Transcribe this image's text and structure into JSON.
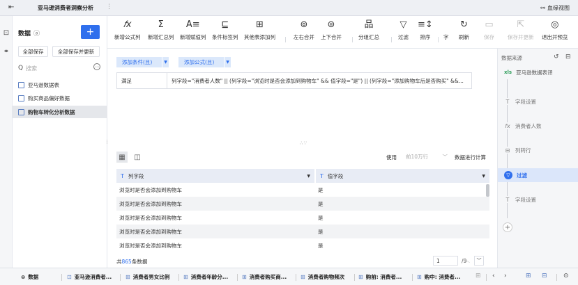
{
  "titlebar": {
    "back_icon": "exit-icon",
    "tab_name": "亚马逊消费者洞察分析",
    "more": "⋮",
    "blood_view": "血缘视图"
  },
  "data_panel": {
    "title": "数据",
    "help": "ⓐ",
    "add": "+",
    "save_all": "全部保存",
    "save_all_update": "全部保存并更新",
    "search_placeholder": "搜索",
    "items": [
      {
        "label": "亚马逊数据表"
      },
      {
        "label": "购买商品偏好数据"
      },
      {
        "label": "购物车转化分析数据"
      }
    ]
  },
  "toolbar": {
    "items": [
      {
        "label": "新增公式列",
        "glyph": "fx"
      },
      {
        "label": "新增汇总列",
        "glyph": "Σ"
      },
      {
        "label": "新增赋值列",
        "glyph": "A≡"
      },
      {
        "label": "条件标签列",
        "glyph": "⊑"
      },
      {
        "label": "其他表添加列",
        "glyph": "⊞"
      },
      {
        "label": "左右合并",
        "glyph": "⊚"
      },
      {
        "label": "上下合并",
        "glyph": "⊜"
      },
      {
        "label": "分组汇总",
        "glyph": "品"
      },
      {
        "label": "过滤",
        "glyph": "▽"
      },
      {
        "label": "排序",
        "glyph": "≡↕"
      },
      {
        "label": "字",
        "glyph": ""
      },
      {
        "label": "刷新",
        "glyph": "↻"
      },
      {
        "label": "保存",
        "glyph": "▭"
      },
      {
        "label": "保存并更新",
        "glyph": "⇱"
      },
      {
        "label": "退出并预览",
        "glyph": "◎"
      }
    ]
  },
  "filter": {
    "add_condition": "添加条件(且)",
    "add_formula": "添加公式(且)",
    "satisfy": "满足",
    "expression": "列字段=\"消费者人数\" || (列字段=\"浏览时是否会添加到购物车\" && 值字段=\"是\") || (列字段=\"添加购物车后是否购买\" &&..."
  },
  "preview": {
    "use_label": "使用",
    "use_select": "前10万行",
    "calc_label": "数据进行计算",
    "columns": [
      {
        "name": "列字段"
      },
      {
        "name": "值字段"
      }
    ],
    "rows": [
      [
        "浏览时是否会添加到购物车",
        "是"
      ],
      [
        "浏览时是否会添加到购物车",
        "是"
      ],
      [
        "浏览时是否会添加到购物车",
        "是"
      ],
      [
        "浏览时是否会添加到购物车",
        "是"
      ],
      [
        "浏览时是否会添加到购物车",
        "是"
      ]
    ],
    "total_prefix": "共",
    "total_count": "865",
    "total_suffix": "条数据",
    "page_current": "1",
    "page_total": "/9"
  },
  "steps": {
    "header": "数据来源",
    "items": [
      {
        "label": "亚马逊数据表译",
        "icon": "xls",
        "kind": "src"
      },
      {
        "label": "字段设置",
        "icon": "T▫",
        "kind": "normal"
      },
      {
        "label": "消费者人数",
        "icon": "fx",
        "kind": "normal"
      },
      {
        "label": "列转行",
        "icon": "⊟",
        "kind": "normal"
      },
      {
        "label": "过滤",
        "icon": "▽",
        "kind": "on"
      },
      {
        "label": "字段设置",
        "icon": "T▫",
        "kind": "normal"
      }
    ]
  },
  "bottom": {
    "data_tab": "数据",
    "tabs": [
      "亚马逊消费者...",
      "消费者男女比例",
      "消费者年龄分...",
      "消费者购买商...",
      "消费者购物频次",
      "购前: 消费者...",
      "购中: 消费者..."
    ]
  },
  "colors": {
    "accent": "#2f6fed",
    "active_step_bg": "#dbe6fa",
    "header_bg": "#e8ecf5"
  }
}
